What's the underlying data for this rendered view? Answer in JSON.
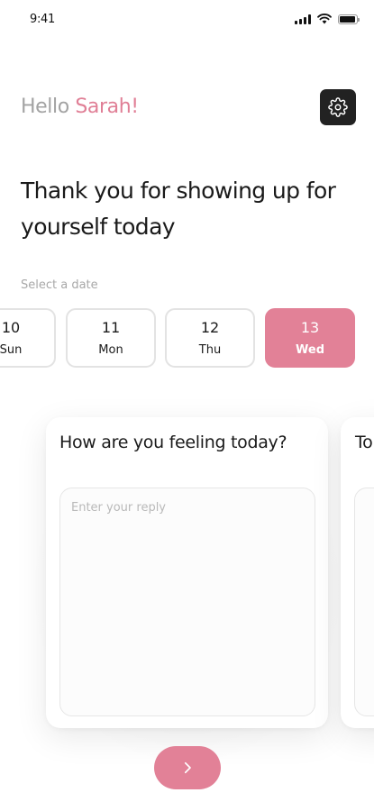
{
  "status_bar": {
    "time": "9:41"
  },
  "greeting": {
    "hello": "Hello",
    "name": "Sarah!"
  },
  "headline": "Thank you for showing up for yourself today",
  "date_picker": {
    "label": "Select a date",
    "dates": [
      {
        "num": "10",
        "day": "Sun",
        "selected": false
      },
      {
        "num": "11",
        "day": "Mon",
        "selected": false
      },
      {
        "num": "12",
        "day": "Thu",
        "selected": false
      },
      {
        "num": "13",
        "day": "Wed",
        "selected": true
      }
    ]
  },
  "questions": [
    {
      "text": "How are you feeling today?",
      "placeholder": "Enter your reply"
    },
    {
      "text": "To"
    }
  ],
  "icons": {
    "settings": "gear-icon",
    "next": "chevron-right-icon"
  },
  "colors": {
    "accent": "#e28197",
    "name_highlight": "#e07f96",
    "settings_button": "#222222"
  }
}
